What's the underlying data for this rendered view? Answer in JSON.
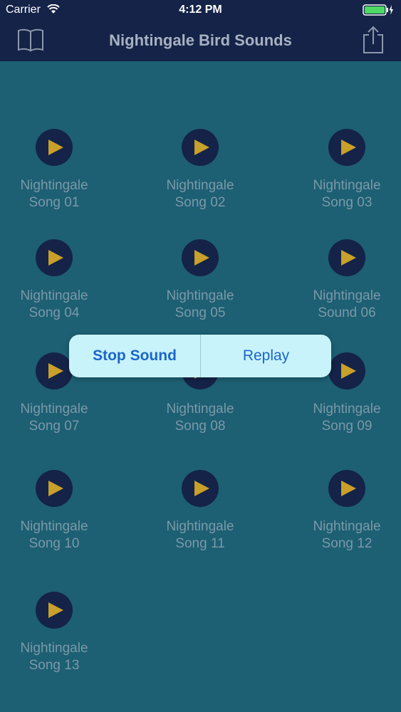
{
  "status_bar": {
    "carrier": "Carrier",
    "time": "4:12 PM"
  },
  "nav": {
    "title": "Nightingale Bird Sounds",
    "left_icon": "book-icon",
    "right_icon": "share-icon"
  },
  "colors": {
    "background": "#1d5f73",
    "bar": "#142347",
    "play_triangle": "#c8a02a",
    "label": "#7a99a8",
    "popup": "#c8f3fb",
    "popup_text": "#1c66c9"
  },
  "sounds": [
    {
      "line1": "Nightingale",
      "line2": "Song 01"
    },
    {
      "line1": "Nightingale",
      "line2": "Song 02"
    },
    {
      "line1": "Nightingale",
      "line2": "Song 03"
    },
    {
      "line1": "Nightingale",
      "line2": "Song 04"
    },
    {
      "line1": "Nightingale",
      "line2": "Song 05"
    },
    {
      "line1": "Nightingale",
      "line2": "Sound 06"
    },
    {
      "line1": "Nightingale",
      "line2": "Song 07"
    },
    {
      "line1": "Nightingale",
      "line2": "Song 08"
    },
    {
      "line1": "Nightingale",
      "line2": "Song 09"
    },
    {
      "line1": "Nightingale",
      "line2": "Song 10"
    },
    {
      "line1": "Nightingale",
      "line2": "Song 11"
    },
    {
      "line1": "Nightingale",
      "line2": "Song 12"
    },
    {
      "line1": "Nightingale",
      "line2": "Song 13"
    }
  ],
  "popup": {
    "stop_label": "Stop Sound",
    "replay_label": "Replay"
  }
}
